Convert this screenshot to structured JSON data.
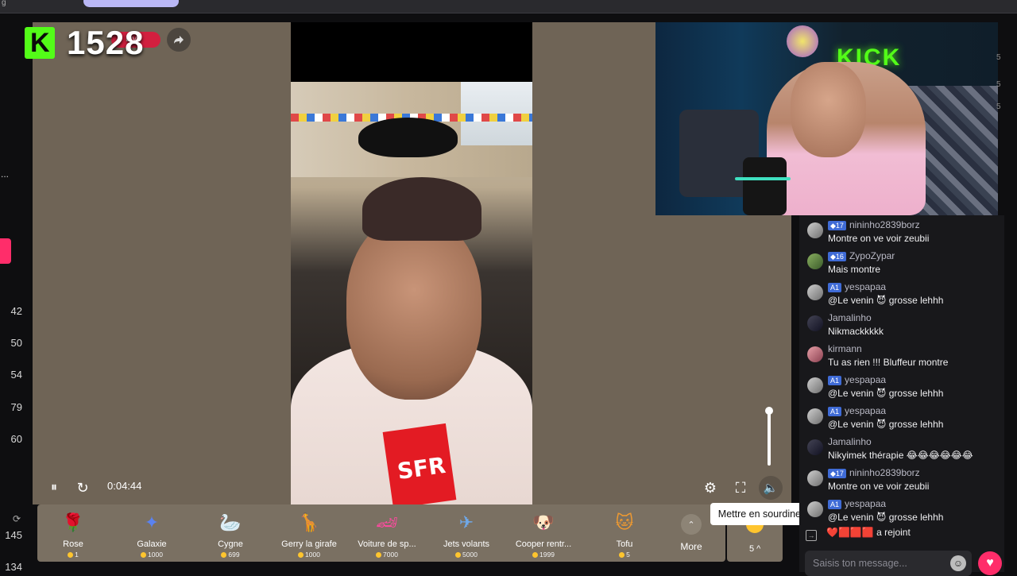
{
  "browser": {
    "tab_text": "g",
    "accent": "#b9b7f5"
  },
  "left_column": {
    "dots": "...",
    "numbers": [
      "42",
      "50",
      "54",
      "79",
      "60",
      "145",
      "134"
    ],
    "refresh_glyph": "⟳"
  },
  "stream": {
    "logo_letter": "K",
    "viewer_count": "1528",
    "live_label": "Live",
    "share_icon": "share-icon",
    "elapsed": "0:04:44",
    "icons": {
      "pause": "⏸",
      "reload": "↻",
      "settings": "⚙",
      "fullscreen": "⛶",
      "volume": "🔈"
    },
    "volume_level": 1.0,
    "tooltip": "Mettre en sourdine (M)"
  },
  "video": {
    "shirt_logo": "SFR"
  },
  "webcam": {
    "sign_text": "KICK"
  },
  "gifts": [
    {
      "name": "Rose",
      "cost": "1",
      "icon": "🌹",
      "color": "#d9302f"
    },
    {
      "name": "Galaxie",
      "cost": "1000",
      "icon": "✦",
      "color": "#5a82f0"
    },
    {
      "name": "Cygne",
      "cost": "699",
      "icon": "🦢",
      "color": "#dfe8f5"
    },
    {
      "name": "Gerry la girafe",
      "cost": "1000",
      "icon": "🦒",
      "color": "#e0b050"
    },
    {
      "name": "Voiture de sp...",
      "cost": "7000",
      "icon": "🏎",
      "color": "#ff4aa0"
    },
    {
      "name": "Jets volants",
      "cost": "5000",
      "icon": "✈",
      "color": "#6fa8e8"
    },
    {
      "name": "Cooper rentr...",
      "cost": "1999",
      "icon": "🐶",
      "color": "#f0c060"
    },
    {
      "name": "Tofu",
      "cost": "5",
      "icon": "🐱",
      "color": "#f09a30"
    }
  ],
  "gifts_more": {
    "label": "More",
    "arrow": "⌃"
  },
  "coins": {
    "count": "5 ^"
  },
  "chat": {
    "messages": [
      {
        "badge": "◆17",
        "user": "nininho2839borz",
        "text": "Montre on ve voir zeubii"
      },
      {
        "badge": "◆16",
        "user": "ZypoZypar",
        "text": "Mais montre"
      },
      {
        "badge": "A1",
        "user": "yespapaa",
        "text": "@Le venin 😈 grosse lehhh"
      },
      {
        "badge": "",
        "user": "Jamalinho",
        "text": "Nikmackkkkk"
      },
      {
        "badge": "",
        "user": "kirmann",
        "text": "Tu as rien !!! Bluffeur montre"
      },
      {
        "badge": "A1",
        "user": "yespapaa",
        "text": "@Le venin 😈 grosse lehhh"
      },
      {
        "badge": "A1",
        "user": "yespapaa",
        "text": "@Le venin 😈 grosse lehhh"
      },
      {
        "badge": "",
        "user": "Jamalinho",
        "text": "Nikyimek thérapie 😂😂😂😂😂😂"
      },
      {
        "badge": "◆17",
        "user": "nininho2839borz",
        "text": "Montre on ve voir zeubii"
      },
      {
        "badge": "A1",
        "user": "yespapaa",
        "text": "@Le venin 😈 grosse lehhh"
      }
    ],
    "join_text": "❤️🟥🟥🟥 a rejoint",
    "input_placeholder": "Saisis ton message...",
    "emoji_icon": "☺",
    "heart_icon": "♥"
  },
  "right_edge_digits": [
    "5",
    "5",
    "5"
  ]
}
